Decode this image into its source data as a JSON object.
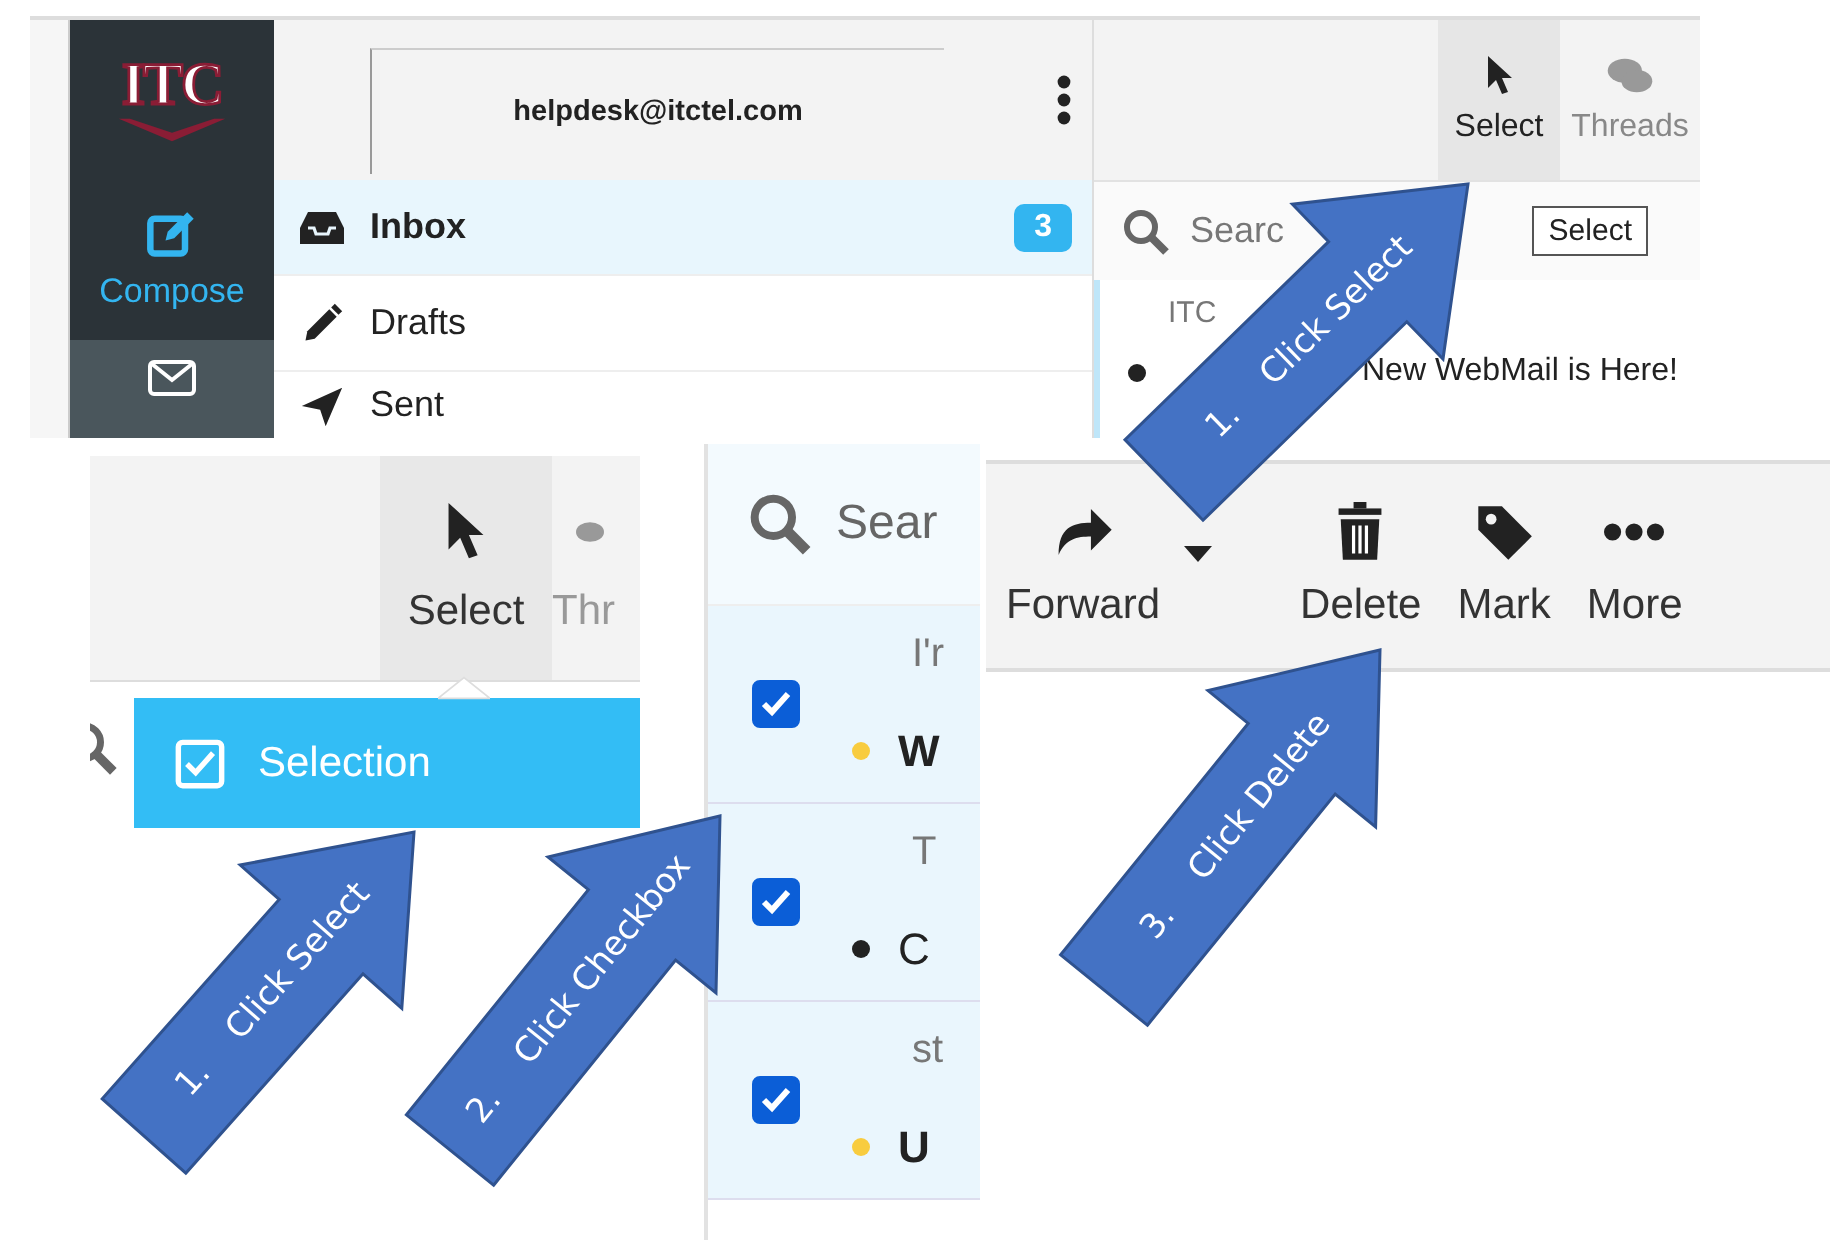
{
  "app": {
    "logo": "ITC",
    "compose": "Compose"
  },
  "account": {
    "email": "helpdesk@itctel.com"
  },
  "folders": [
    {
      "name": "Inbox",
      "selected": true,
      "count": "3"
    },
    {
      "name": "Drafts",
      "selected": false
    },
    {
      "name": "Sent",
      "selected": false
    }
  ],
  "toolbar": [
    {
      "label": "Select",
      "selected": true
    },
    {
      "label": "Threads",
      "selected": false
    }
  ],
  "search": {
    "placeholder": "Searc"
  },
  "tooltip": "Select",
  "message": {
    "sender": "ITC",
    "subject": "New WebMail is Here!",
    "unread": false,
    "color": "#222222"
  },
  "select_panel": {
    "toolbar": [
      {
        "label": "Select",
        "selected": true
      },
      {
        "label": "Thr",
        "selected": false
      }
    ],
    "menu_item": "Selection"
  },
  "list_panel": {
    "placeholder": "Sear",
    "rows": [
      {
        "sender": "I'r",
        "subject": "W",
        "checked": true,
        "unread": true,
        "color": "#f8cc3f"
      },
      {
        "sender": "T",
        "subject": "C",
        "checked": true,
        "unread": false,
        "color": "#222222"
      },
      {
        "sender": "st",
        "subject": "U",
        "checked": true,
        "unread": true,
        "color": "#f8cc3f"
      }
    ]
  },
  "actions": [
    {
      "label": "Forward",
      "kind": "split"
    },
    {
      "label": "Delete",
      "kind": "plain"
    },
    {
      "label": "Mark",
      "kind": "plain"
    },
    {
      "label": "More",
      "kind": "plain"
    }
  ],
  "arrows": [
    {
      "label": "1.    Click Select"
    },
    {
      "label": "1.    Click Select"
    },
    {
      "label": "2.    Click Checkbox"
    },
    {
      "label": "3.    Click Delete"
    }
  ]
}
